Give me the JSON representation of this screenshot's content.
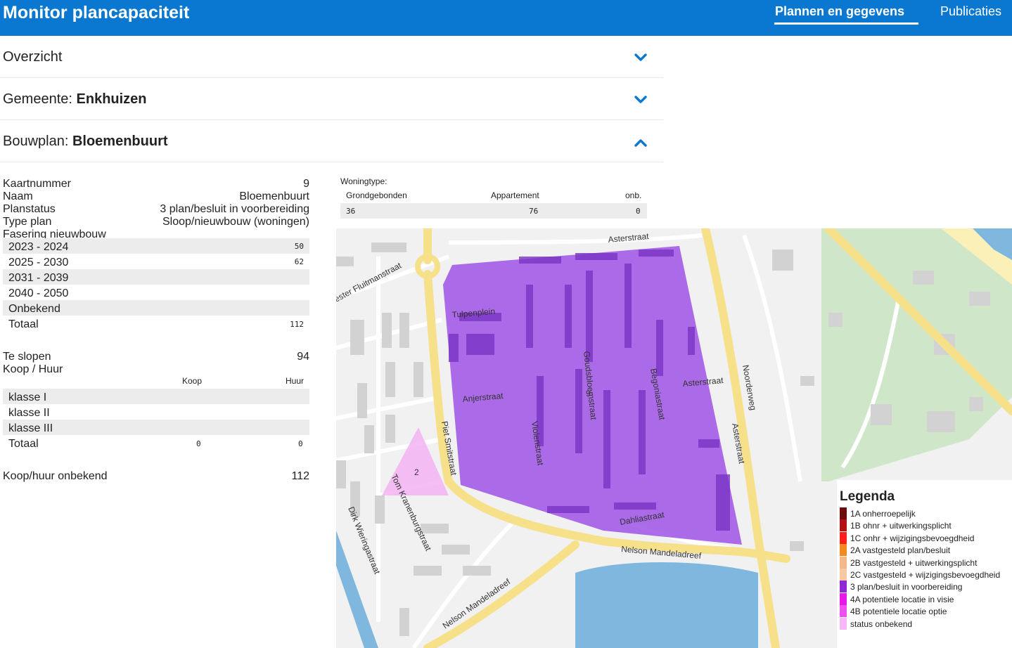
{
  "header": {
    "title": "Monitor plancapaciteit",
    "nav": [
      {
        "label": "Plannen en gegevens",
        "active": true
      },
      {
        "label": "Publicaties",
        "active": false
      }
    ]
  },
  "accordion": {
    "overview": {
      "label": "Overzicht",
      "expanded": false
    },
    "municipality": {
      "prefix": "Gemeente: ",
      "value": "Enkhuizen",
      "expanded": false
    },
    "plan": {
      "prefix": "Bouwplan: ",
      "value": "Bloemenbuurt",
      "expanded": true
    }
  },
  "details": {
    "fields": [
      {
        "key": "Kaartnummer",
        "value": "9"
      },
      {
        "key": "Naam",
        "value": "Bloemenbuurt"
      },
      {
        "key": "Planstatus",
        "value": "3 plan/besluit in voorbereiding"
      },
      {
        "key": "Type plan",
        "value": "Sloop/nieuwbouw (woningen)"
      }
    ],
    "phasing_label": "Fasering nieuwbouw",
    "phasing": [
      {
        "period": "2023 - 2024",
        "value": "50"
      },
      {
        "period": "2025 - 2030",
        "value": "62"
      },
      {
        "period": "2031 - 2039",
        "value": ""
      },
      {
        "period": "2040 - 2050",
        "value": ""
      },
      {
        "period": "Onbekend",
        "value": ""
      },
      {
        "period": "Totaal",
        "value": "112"
      }
    ],
    "demolish": {
      "key": "Te slopen",
      "value": "94"
    },
    "koop_huur_label": "Koop / Huur",
    "koop_header": "Koop",
    "huur_header": "Huur",
    "classes": [
      {
        "label": "klasse I",
        "koop": "",
        "huur": ""
      },
      {
        "label": "klasse II",
        "koop": "",
        "huur": ""
      },
      {
        "label": "klasse III",
        "koop": "",
        "huur": ""
      },
      {
        "label": "Totaal",
        "koop": "0",
        "huur": "0"
      }
    ],
    "unknown": {
      "key": "Koop/huur onbekend",
      "value": "112"
    }
  },
  "woningtype": {
    "label": "Woningtype:",
    "headers": [
      "Grondgebonden",
      "Appartement",
      "onb."
    ],
    "values": [
      "36",
      "76",
      "0"
    ]
  },
  "map": {
    "streets": [
      "Asterstraat",
      "ester Fluitmanstraat",
      "Tulpenplein",
      "Goudsbloemstraat",
      "Begoniastraat",
      "Asterstraat",
      "Noorderweg",
      "Anjerstraat",
      "Violenstraat",
      "Piet Smitstraat",
      "Asterstraat",
      "Dahliastraat",
      "Nelson Mandeladreef",
      "Tom Kranenburgstraat",
      "Dirk Wieringastraat",
      "Nelson Mandeladreef"
    ],
    "plan_labels": [
      "9",
      "2"
    ],
    "colors": {
      "plan_purple": "#9b4de6",
      "plan_pink": "#f3b3f3",
      "road_yellow": "#f7e08a",
      "water": "#7fb7df",
      "green": "#cfe6c9"
    }
  },
  "legend": {
    "title": "Legenda",
    "items": [
      {
        "label": "1A onherroepelijk",
        "color": "#6b0d0d"
      },
      {
        "label": "1B ohnr + uitwerkingsplicht",
        "color": "#b31212"
      },
      {
        "label": "1C onhr + wijzigingsbevoegdheid",
        "color": "#ff1f1f"
      },
      {
        "label": "2A vastgesteld plan/besluit",
        "color": "#f28a1e"
      },
      {
        "label": "2B vastgesteld + uitwerkingsplicht",
        "color": "#f4b78a"
      },
      {
        "label": "2C vastgesteld + wijzigingsbevoegdheid",
        "color": "#f6c9a3"
      },
      {
        "label": "3 plan/besluit in voorbereiding",
        "color": "#8d2ad6"
      },
      {
        "label": "4A potentiele locatie in visie",
        "color": "#e619e6"
      },
      {
        "label": "4B potentiele locatie optie",
        "color": "#f04ff0"
      },
      {
        "label": "status onbekend",
        "color": "#f7b6f7"
      }
    ]
  }
}
